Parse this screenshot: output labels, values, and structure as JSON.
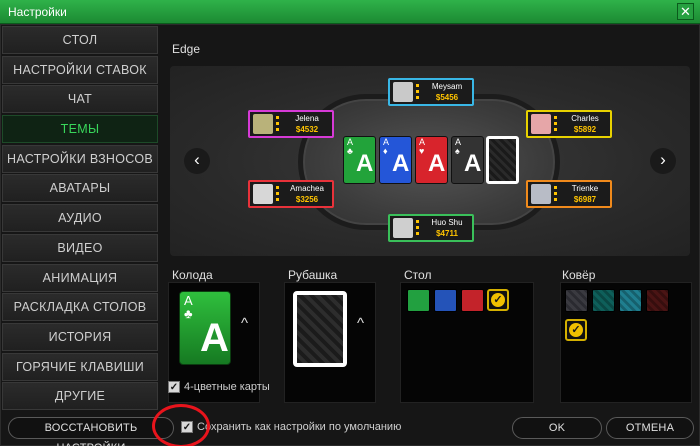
{
  "window": {
    "title": "Настройки",
    "close_icon": "close-icon"
  },
  "sidebar": {
    "items": [
      {
        "label": "СТОЛ"
      },
      {
        "label": "НАСТРОЙКИ СТАВОК"
      },
      {
        "label": "ЧАТ"
      },
      {
        "label": "ТЕМЫ",
        "active": true
      },
      {
        "label": "НАСТРОЙКИ ВЗНОСОВ"
      },
      {
        "label": "АВАТАРЫ"
      },
      {
        "label": "АУДИО"
      },
      {
        "label": "ВИДЕО"
      },
      {
        "label": "АНИМАЦИЯ"
      },
      {
        "label": "РАСКЛАДКА СТОЛОВ"
      },
      {
        "label": "ИСТОРИЯ"
      },
      {
        "label": "ГОРЯЧИЕ КЛАВИШИ"
      },
      {
        "label": "ДРУГИЕ"
      }
    ]
  },
  "theme": {
    "name": "Edge",
    "players": [
      {
        "name": "Meysam",
        "chips": "$5456",
        "color": "#39b7e6"
      },
      {
        "name": "Jelena",
        "chips": "$4532",
        "color": "#d63ad6"
      },
      {
        "name": "Charles",
        "chips": "$5892",
        "color": "#e8d200"
      },
      {
        "name": "Amachea",
        "chips": "$3256",
        "color": "#e8323a"
      },
      {
        "name": "Trienke",
        "chips": "$6987",
        "color": "#f08a1c"
      },
      {
        "name": "Huo Shu",
        "chips": "$4711",
        "color": "#3ac05a"
      }
    ],
    "cards": [
      {
        "rank": "A",
        "suit": "♣",
        "color": "#22a33a"
      },
      {
        "rank": "A",
        "suit": "♦",
        "color": "#2456d8"
      },
      {
        "rank": "A",
        "suit": "♥",
        "color": "#d8242c"
      },
      {
        "rank": "A",
        "suit": "♠",
        "color": "#333333"
      }
    ],
    "prev_icon": "chevron-left-icon",
    "next_icon": "chevron-right-icon"
  },
  "options": {
    "deck": {
      "label": "Колода",
      "card_rank": "A",
      "card_suit": "♣",
      "card_color": "#1f9a2e"
    },
    "back": {
      "label": "Рубашка"
    },
    "table": {
      "label": "Стол",
      "colors": [
        "#22a040",
        "#2453b8",
        "#c3232a",
        "#333333"
      ],
      "selected_index": 3
    },
    "carpet": {
      "label": "Ковёр",
      "colors": [
        "#3a3a40",
        "#0e5f5a",
        "#1f7e8f",
        "#4a1414"
      ],
      "selected_index": 4
    },
    "four_color": {
      "label": "4-цветные карты",
      "checked": true
    }
  },
  "footer": {
    "restore_label": "ВОССТАНОВИТЬ НАСТРОЙКИ",
    "save_default_label": "Сохранить как настройки по умолчанию",
    "save_default_checked": true,
    "ok_label": "OK",
    "cancel_label": "ОТМЕНА"
  },
  "colors": {
    "accent": "#2fb24a",
    "active_text": "#38d65a",
    "highlight_circle": "#e8141c"
  }
}
